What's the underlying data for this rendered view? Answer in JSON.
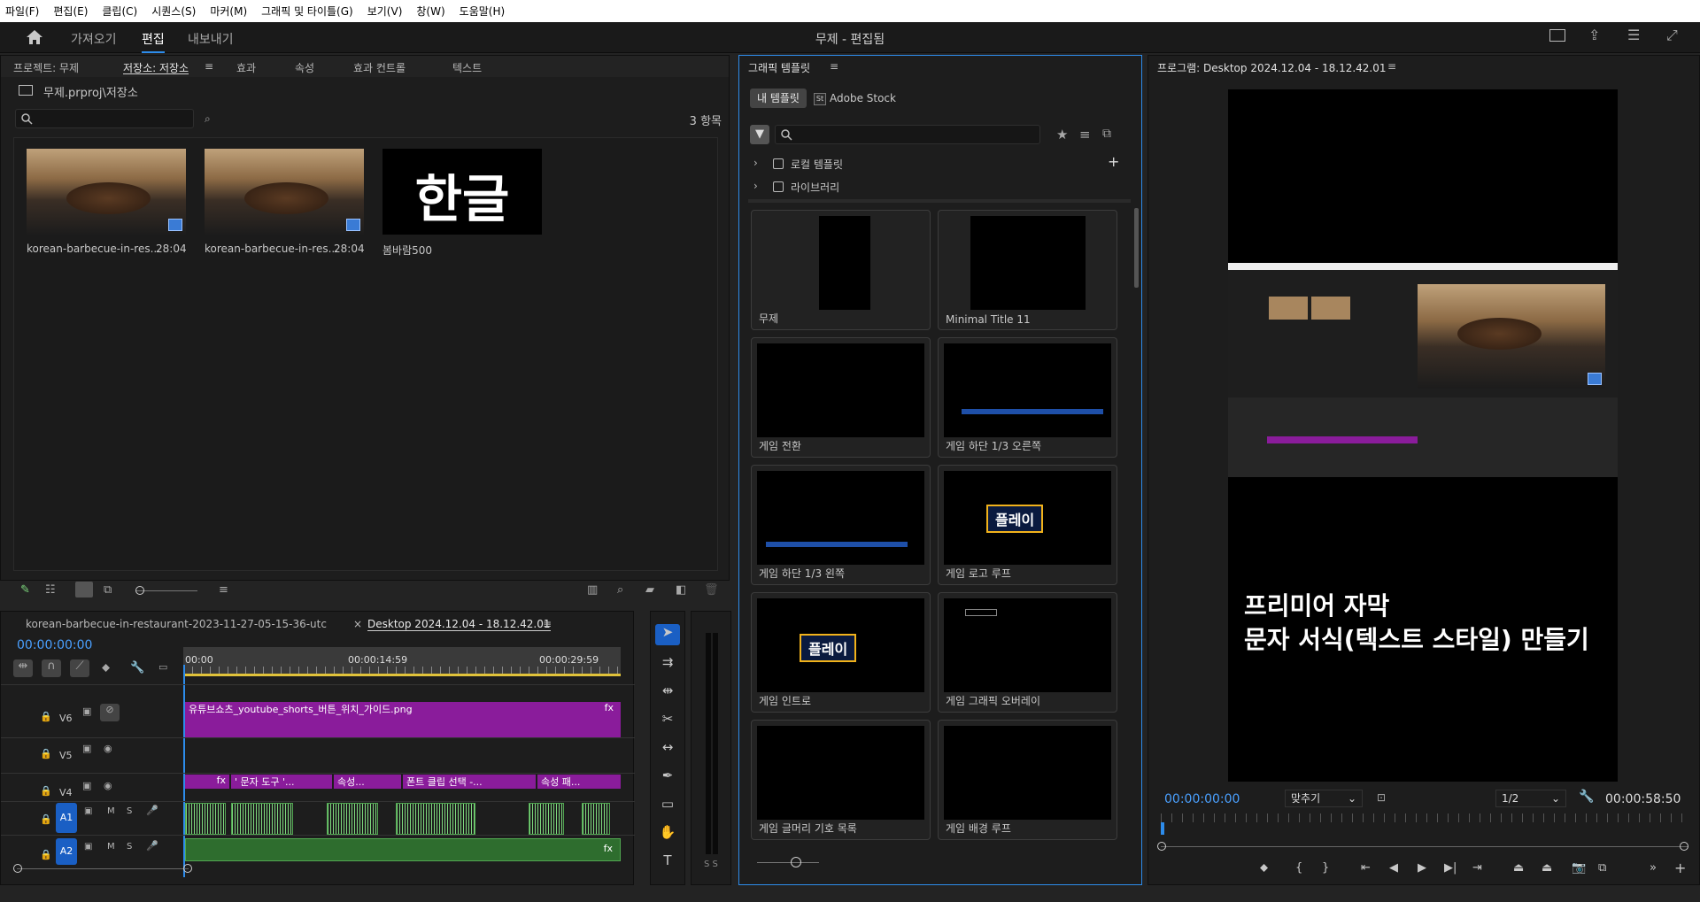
{
  "menu": [
    "파일(F)",
    "편집(E)",
    "클립(C)",
    "시퀀스(S)",
    "마커(M)",
    "그래픽 및 타이틀(G)",
    "보기(V)",
    "창(W)",
    "도움말(H)"
  ],
  "workspace": {
    "tabs": [
      "가져오기",
      "편집",
      "내보내기"
    ],
    "title": "무제 - 편집됨"
  },
  "project": {
    "tabs": [
      "프로젝트: 무제",
      "저장소: 저장소",
      "효과",
      "속성",
      "효과 컨트롤",
      "텍스트"
    ],
    "path": "무제.prproj\\저장소",
    "count": "3 항목",
    "items": [
      {
        "name": "korean-barbecue-in-res...",
        "duration": "28:04"
      },
      {
        "name": "korean-barbecue-in-res...",
        "duration": "28:04"
      },
      {
        "name": "봄바람500",
        "duration": "",
        "preview_text": "한글"
      }
    ]
  },
  "graphics": {
    "title": "그래픽 템플릿",
    "tabs": [
      "내 템플릿",
      "Adobe Stock"
    ],
    "stock_badge": "St",
    "folders": [
      "로컬 템플릿",
      "라이브러리"
    ],
    "templates": [
      "무제",
      "Minimal Title 11",
      "게임 전환",
      "게임 하단 1/3 오른쪽",
      "게임 하단 1/3 왼쪽",
      "게임 로고 루프",
      "게임 인트로",
      "게임 그래픽 오버레이",
      "게임 글머리 기호 목록",
      "게임 배경 루프"
    ],
    "logo_text": "플레이"
  },
  "program": {
    "title": "프로그램: Desktop 2024.12.04 - 18.12.42.01",
    "timecode": "00:00:00:00",
    "fit": "맞추기",
    "resolution": "1/2",
    "duration": "00:00:58:50",
    "caption_line1": "프리미어 자막",
    "caption_line2": "문자 서식(텍스트 스타일) 만들기"
  },
  "timeline": {
    "tabs": [
      "korean-barbecue-in-restaurant-2023-11-27-05-15-36-utc",
      "Desktop 2024.12.04 - 18.12.42.01"
    ],
    "timecode": "00:00:00:00",
    "ruler": [
      "00:00",
      "00:00:14:59",
      "00:00:29:59"
    ],
    "tracks": [
      "V6",
      "V5",
      "V4",
      "A1",
      "A2"
    ],
    "clips": [
      {
        "track": "V6",
        "label": "유튜브쇼츠_youtube_shorts_버튼_위치_가이드.png"
      },
      {
        "track": "V4",
        "label": "' 문자 도구 '..."
      },
      {
        "track": "V4",
        "label": "속성..."
      },
      {
        "track": "V4",
        "label": "폰트 클립 선택 -..."
      },
      {
        "track": "V4",
        "label": "속성 패..."
      }
    ],
    "fx": "fx",
    "meter_labels": "S S"
  }
}
